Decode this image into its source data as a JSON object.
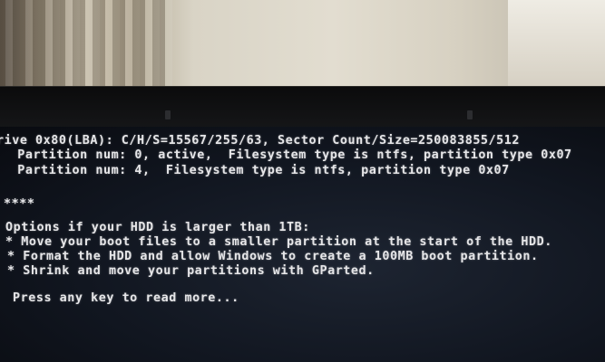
{
  "terminal": {
    "lines": [
      "rive 0x80(LBA): C/H/S=15567/255/63, Sector Count/Size=250083855/512",
      "  Partition num: 0, active,  Filesystem type is ntfs, partition type 0x07",
      "  Partition num: 4,  Filesystem type is ntfs, partition type 0x07",
      "",
      "****",
      "",
      "Options if your HDD is larger than 1TB:",
      "* Move your boot files to a smaller partition at the start of the HDD.",
      "* Format the HDD and allow Windows to create a 100MB boot partition.",
      "* Shrink and move your partitions with GParted.",
      "",
      "Press any key to read more..."
    ]
  }
}
